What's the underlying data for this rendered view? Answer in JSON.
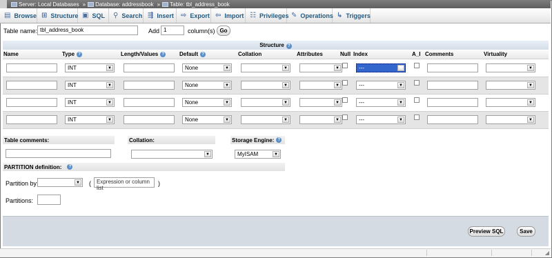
{
  "breadcrumb": {
    "server": "Server: Local Databases",
    "database": "Database: addressbook",
    "table": "Table: tbl_address_book",
    "separator": "»"
  },
  "tabs": [
    {
      "label": "Browse",
      "icon": "browse-icon"
    },
    {
      "label": "Structure",
      "icon": "structure-icon"
    },
    {
      "label": "SQL",
      "icon": "sql-icon"
    },
    {
      "label": "Search",
      "icon": "search-icon"
    },
    {
      "label": "Insert",
      "icon": "insert-icon"
    },
    {
      "label": "Export",
      "icon": "export-icon"
    },
    {
      "label": "Import",
      "icon": "import-icon"
    },
    {
      "label": "Privileges",
      "icon": "privileges-icon"
    },
    {
      "label": "Operations",
      "icon": "operations-icon"
    },
    {
      "label": "Triggers",
      "icon": "triggers-icon"
    }
  ],
  "form": {
    "table_name_label": "Table name:",
    "table_name_value": "tbl_address_book",
    "add_label": "Add",
    "add_value": "1",
    "columns_label": "column(s)",
    "go_label": "Go"
  },
  "structure": {
    "title": "Structure",
    "headers": {
      "name": "Name",
      "type": "Type",
      "length": "Length/Values",
      "default": "Default",
      "collation": "Collation",
      "attributes": "Attributes",
      "null": "Null",
      "index": "Index",
      "ai": "A_I",
      "comments": "Comments",
      "virtuality": "Virtuality"
    },
    "rows": [
      {
        "name": "",
        "type": "INT",
        "length": "",
        "default": "None",
        "collation": "",
        "attributes": "",
        "index": "---",
        "comments": "",
        "virtuality": ""
      },
      {
        "name": "",
        "type": "INT",
        "length": "",
        "default": "None",
        "collation": "",
        "attributes": "",
        "index": "---",
        "comments": "",
        "virtuality": ""
      },
      {
        "name": "",
        "type": "INT",
        "length": "",
        "default": "None",
        "collation": "",
        "attributes": "",
        "index": "---",
        "comments": "",
        "virtuality": ""
      },
      {
        "name": "",
        "type": "INT",
        "length": "",
        "default": "None",
        "collation": "",
        "attributes": "",
        "index": "---",
        "comments": "",
        "virtuality": ""
      }
    ]
  },
  "table_options": {
    "comments_label": "Table comments:",
    "collation_label": "Collation:",
    "engine_label": "Storage Engine:",
    "engine_value": "MyISAM",
    "partition_label": "PARTITION definition:",
    "partition_by_label": "Partition by:",
    "paren_open": "(",
    "paren_close": ")",
    "expression_placeholder": "Expression or column list",
    "partitions_label": "Partitions:"
  },
  "actions": {
    "preview_sql": "Preview SQL",
    "save": "Save"
  },
  "colors": {
    "tab_text": "#235a81",
    "selected_index": "#3366cc",
    "bottom_panel": "#d4dbe2"
  }
}
